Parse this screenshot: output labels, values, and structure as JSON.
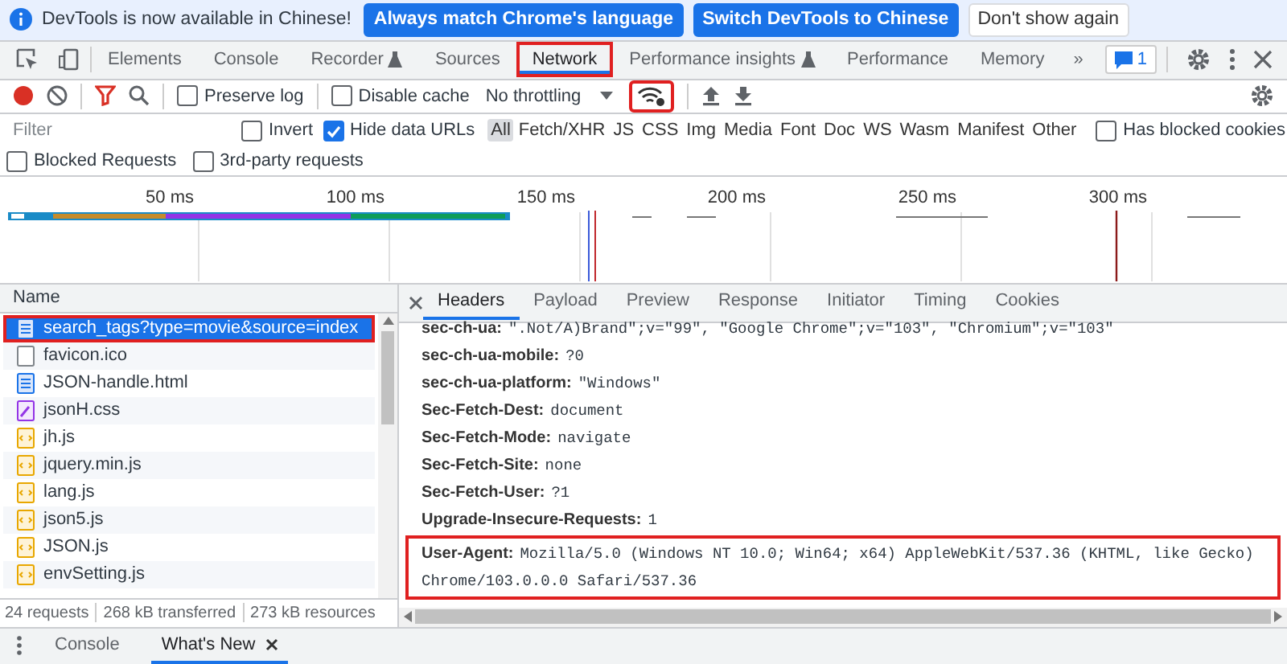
{
  "infobar": {
    "message": "DevTools is now available in Chinese!",
    "buttons": [
      {
        "label": "Always match Chrome's language",
        "kind": "primary"
      },
      {
        "label": "Switch DevTools to Chinese",
        "kind": "primary"
      },
      {
        "label": "Don't show again",
        "kind": "plain"
      }
    ]
  },
  "panel_tabs": [
    {
      "label": "Elements",
      "selected": false,
      "annotated": false,
      "experimental": false
    },
    {
      "label": "Console",
      "selected": false,
      "annotated": false,
      "experimental": false
    },
    {
      "label": "Recorder",
      "selected": false,
      "annotated": false,
      "experimental": true
    },
    {
      "label": "Sources",
      "selected": false,
      "annotated": false,
      "experimental": false
    },
    {
      "label": "Network",
      "selected": true,
      "annotated": true,
      "experimental": false
    },
    {
      "label": "Performance insights",
      "selected": false,
      "annotated": false,
      "experimental": true
    },
    {
      "label": "Performance",
      "selected": false,
      "annotated": false,
      "experimental": false
    },
    {
      "label": "Memory",
      "selected": false,
      "annotated": false,
      "experimental": false
    }
  ],
  "overflow": "»",
  "issues_count": "1",
  "toolbar": {
    "recording": true,
    "preserve_log": {
      "label": "Preserve log",
      "checked": false
    },
    "disable_cache": {
      "label": "Disable cache",
      "checked": false
    },
    "throttling": "No throttling",
    "network_conditions_annotated": true
  },
  "filter": {
    "placeholder": "Filter",
    "invert": {
      "label": "Invert",
      "checked": false
    },
    "hide_data_urls": {
      "label": "Hide data URLs",
      "checked": true
    },
    "types": [
      {
        "label": "All",
        "selected": true
      },
      {
        "label": "Fetch/XHR",
        "selected": false
      },
      {
        "label": "JS",
        "selected": false
      },
      {
        "label": "CSS",
        "selected": false
      },
      {
        "label": "Img",
        "selected": false
      },
      {
        "label": "Media",
        "selected": false
      },
      {
        "label": "Font",
        "selected": false
      },
      {
        "label": "Doc",
        "selected": false
      },
      {
        "label": "WS",
        "selected": false
      },
      {
        "label": "Wasm",
        "selected": false
      },
      {
        "label": "Manifest",
        "selected": false
      },
      {
        "label": "Other",
        "selected": false
      }
    ],
    "has_blocked_cookies": {
      "label": "Has blocked cookies",
      "checked": false
    },
    "blocked_requests": {
      "label": "Blocked Requests",
      "checked": false
    },
    "third_party": {
      "label": "3rd-party requests",
      "checked": false
    }
  },
  "overview": {
    "ticks": [
      "50 ms",
      "100 ms",
      "150 ms",
      "200 ms",
      "250 ms",
      "300 ms"
    ]
  },
  "requests": {
    "column": "Name",
    "rows": [
      {
        "name": "search_tags?type=movie&source=index",
        "kind": "document",
        "selected": true,
        "annotated": true
      },
      {
        "name": "favicon.ico",
        "kind": "other",
        "selected": false,
        "annotated": false
      },
      {
        "name": "JSON-handle.html",
        "kind": "document",
        "selected": false,
        "annotated": false
      },
      {
        "name": "jsonH.css",
        "kind": "stylesheet",
        "selected": false,
        "annotated": false
      },
      {
        "name": "jh.js",
        "kind": "script",
        "selected": false,
        "annotated": false
      },
      {
        "name": "jquery.min.js",
        "kind": "script",
        "selected": false,
        "annotated": false
      },
      {
        "name": "lang.js",
        "kind": "script",
        "selected": false,
        "annotated": false
      },
      {
        "name": "json5.js",
        "kind": "script",
        "selected": false,
        "annotated": false
      },
      {
        "name": "JSON.js",
        "kind": "script",
        "selected": false,
        "annotated": false
      },
      {
        "name": "envSetting.js",
        "kind": "script",
        "selected": false,
        "annotated": false
      }
    ],
    "summary": [
      "24 requests",
      "268 kB transferred",
      "273 kB resources"
    ]
  },
  "details": {
    "tabs": [
      {
        "label": "Headers",
        "selected": true
      },
      {
        "label": "Payload",
        "selected": false
      },
      {
        "label": "Preview",
        "selected": false
      },
      {
        "label": "Response",
        "selected": false
      },
      {
        "label": "Initiator",
        "selected": false
      },
      {
        "label": "Timing",
        "selected": false
      },
      {
        "label": "Cookies",
        "selected": false
      }
    ],
    "headers": [
      {
        "name": "sec-ch-ua:",
        "value": "\".Not/A)Brand\";v=\"99\", \"Google Chrome\";v=\"103\", \"Chromium\";v=\"103\"",
        "annotated": false
      },
      {
        "name": "sec-ch-ua-mobile:",
        "value": "?0",
        "annotated": false
      },
      {
        "name": "sec-ch-ua-platform:",
        "value": "\"Windows\"",
        "annotated": false
      },
      {
        "name": "Sec-Fetch-Dest:",
        "value": "document",
        "annotated": false
      },
      {
        "name": "Sec-Fetch-Mode:",
        "value": "navigate",
        "annotated": false
      },
      {
        "name": "Sec-Fetch-Site:",
        "value": "none",
        "annotated": false
      },
      {
        "name": "Sec-Fetch-User:",
        "value": "?1",
        "annotated": false
      },
      {
        "name": "Upgrade-Insecure-Requests:",
        "value": "1",
        "annotated": false
      },
      {
        "name": "User-Agent:",
        "value": "Mozilla/5.0 (Windows NT 10.0; Win64; x64) AppleWebKit/537.36 (KHTML, like Gecko) Chrome/103.0.0.0 Safari/537.36",
        "annotated": true
      }
    ]
  },
  "drawer": {
    "tabs": [
      {
        "label": "Console",
        "selected": false,
        "closable": false
      },
      {
        "label": "What's New",
        "selected": true,
        "closable": true
      }
    ]
  }
}
